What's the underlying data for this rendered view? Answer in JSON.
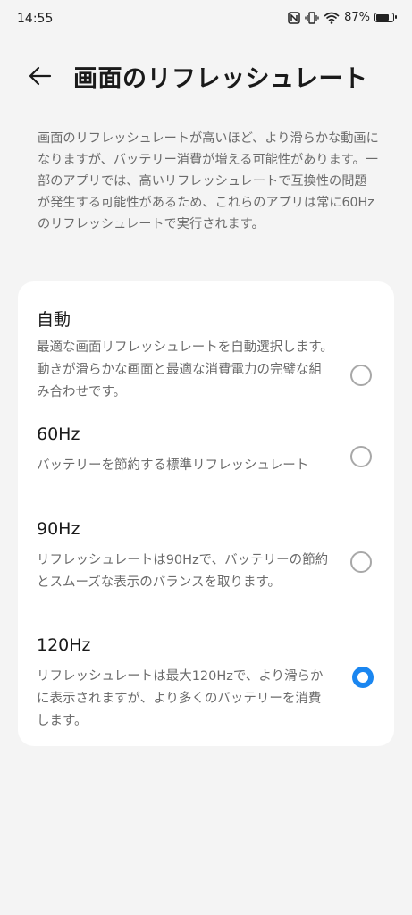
{
  "status_bar": {
    "time": "14:55",
    "battery_percent": "87%",
    "battery_level": 0.87,
    "icons": [
      "nfc-icon",
      "vibrate-icon",
      "wifi-icon",
      "battery-icon"
    ]
  },
  "header": {
    "back_icon": "arrow-left-icon",
    "title": "画面のリフレッシュレート"
  },
  "description": "画面のリフレッシュレートが高いほど、より滑らかな動画になりますが、バッテリー消費が増える可能性があります。一部のアプリでは、高いリフレッシュレートで互換性の問題が発生する可能性があるため、これらのアプリは常に60Hzのリフレッシュレートで実行されます。",
  "options": [
    {
      "title": "自動",
      "description": "最適な画面リフレッシュレートを自動選択します。動きが滑らかな画面と最適な消費電力の完璧な組み合わせです。",
      "selected": false
    },
    {
      "title": "60Hz",
      "description": "バッテリーを節約する標準リフレッシュレート",
      "selected": false
    },
    {
      "title": "90Hz",
      "description": "リフレッシュレートは90Hzで、バッテリーの節約とスムーズな表示のバランスを取ります。",
      "selected": false
    },
    {
      "title": "120Hz",
      "description": "リフレッシュレートは最大120Hzで、より滑らかに表示されますが、より多くのバッテリーを消費します。",
      "selected": true
    }
  ],
  "colors": {
    "accent": "#1a86f0",
    "background": "#f4f4f4",
    "card": "#ffffff"
  }
}
